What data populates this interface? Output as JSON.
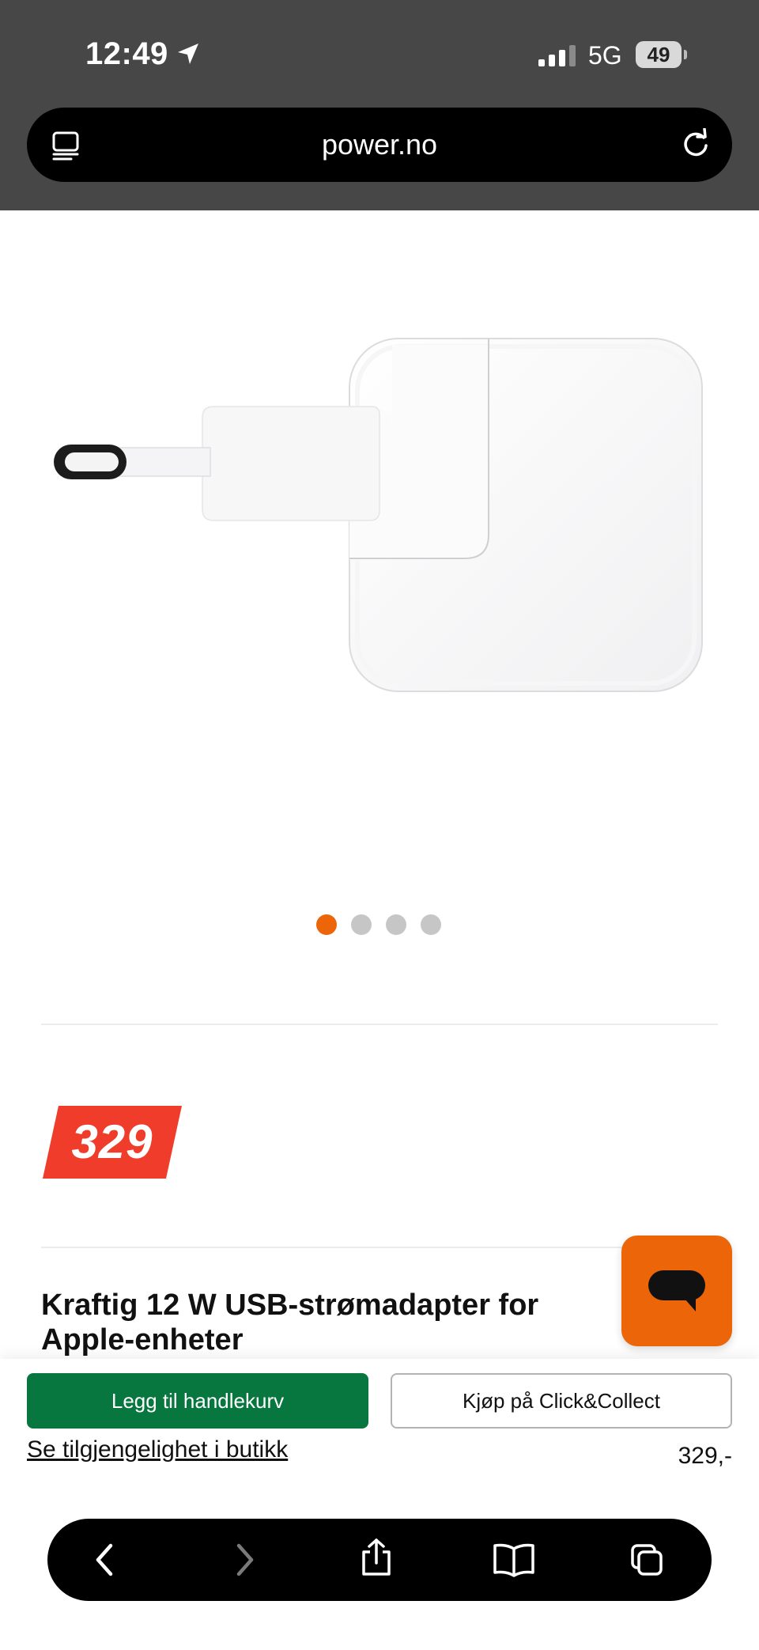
{
  "status_bar": {
    "time": "12:49",
    "network": "5G",
    "battery": "49"
  },
  "browser": {
    "url": "power.no"
  },
  "carousel": {
    "slide_count": 4,
    "active_index": 0,
    "accent_color": "#ec6508"
  },
  "product": {
    "price_badge": "329",
    "title": "Kraftig 12 W USB-strømadapter for Apple-enheter"
  },
  "buy_bar": {
    "add_to_cart_label": "Legg til handlekurv",
    "click_collect_label": "Kjøp på Click&Collect",
    "availability_link": "Se tilgjengelighet i butikk",
    "price": "329,-"
  },
  "colors": {
    "brand_orange": "#ec6508",
    "price_red": "#f03c2b",
    "cart_green": "#07773f"
  },
  "icons": {
    "back": "chevron-left-icon",
    "forward": "chevron-right-icon",
    "share": "share-icon",
    "bookmarks": "book-icon",
    "tabs": "tabs-icon",
    "chat": "chat-bubble-icon"
  }
}
